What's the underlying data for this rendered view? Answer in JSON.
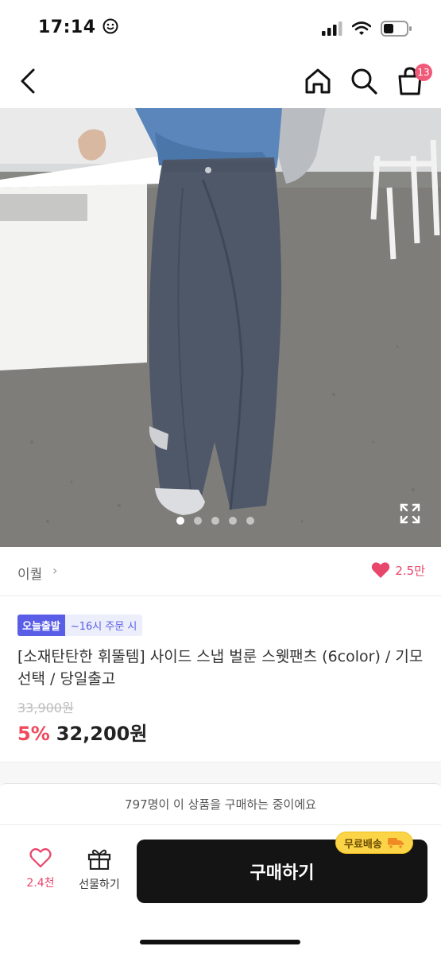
{
  "status_bar": {
    "time": "17:14"
  },
  "nav": {
    "cart_count": "13"
  },
  "gallery": {
    "dot_count": 5,
    "active_index": 0
  },
  "seller": {
    "name": "이퀄",
    "arrow": "›",
    "like_count": "2.5만"
  },
  "product": {
    "badge_today": "오늘출발",
    "badge_time": "~16시 주문 시",
    "title": "[소재탄탄한 휘뚤템] 사이드 스냅 벌룬 스웻팬츠 (6color) / 기모선택 / 당일출고",
    "original_price": "33,900원",
    "discount": "5%",
    "price": "32,200원"
  },
  "purchase_bar": {
    "buyers_text": "797명이 이 상품을 구매하는 중이에요",
    "like_count": "2.4천",
    "gift_label": "선물하기",
    "buy_label": "구매하기",
    "free_shipping": "무료배송"
  },
  "colors": {
    "accent_pink": "#e8466a",
    "discount_red": "#f0495c",
    "badge_purple": "#5a5ee6",
    "buy_button": "#141414",
    "shipping_yellow": "#fcd447"
  },
  "icons": [
    "smiley-icon",
    "signal-icon",
    "wifi-icon",
    "battery-icon",
    "back-icon",
    "home-icon",
    "search-icon",
    "cart-icon",
    "expand-icon",
    "heart-icon",
    "gift-icon",
    "truck-icon"
  ]
}
